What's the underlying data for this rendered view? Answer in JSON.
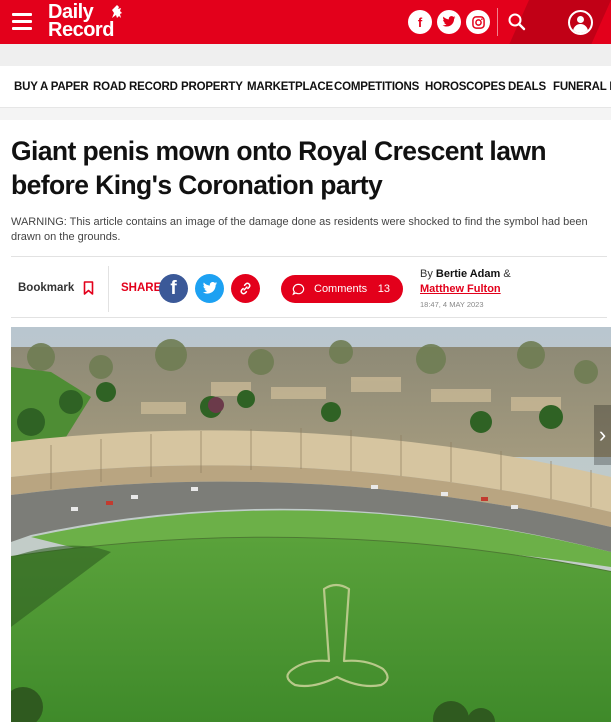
{
  "header": {
    "logo_line1": "Daily",
    "logo_line2": "Record",
    "brand_color": "#e3001b",
    "icons": [
      "menu-icon",
      "facebook-icon",
      "twitter-icon",
      "instagram-icon",
      "search-icon",
      "account-icon"
    ]
  },
  "nav": {
    "items": [
      "BUY A PAPER",
      "ROAD RECORD",
      "PROPERTY",
      "MARKETPLACE",
      "COMPETITIONS",
      "HOROSCOPES",
      "DEALS",
      "FUNERAL N"
    ]
  },
  "article": {
    "headline": "Giant penis mown onto Royal Crescent lawn before King's Coronation party",
    "standfirst": "WARNING: This article contains an image of the damage done as residents were shocked to find the symbol had been drawn on the grounds.",
    "bookmark_label": "Bookmark",
    "share_label": "SHARE",
    "comments_label": "Comments",
    "comments_count": "13",
    "byline_prefix": "By",
    "author1": "Bertie Adam",
    "byline_joiner": "&",
    "author2": "Matthew Fulton",
    "timestamp": "18:47, 4 MAY 2023"
  },
  "share_colors": {
    "facebook": "#3b5998",
    "twitter": "#1da1f2",
    "link": "#e3001b"
  }
}
